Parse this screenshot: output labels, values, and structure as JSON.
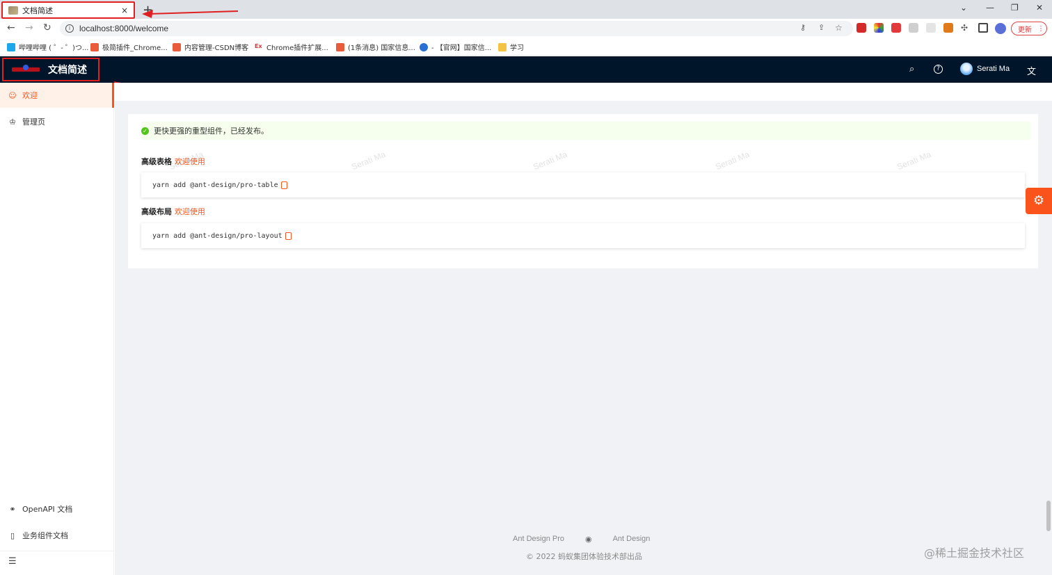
{
  "browser": {
    "tab_title": "文档简述",
    "tab_close": "×",
    "new_tab": "+",
    "url": "localhost:8000/welcome",
    "update_label": "更新",
    "bookmarks": [
      {
        "label": "哔哩哔哩 ( ゜- ゜)つ...",
        "color": "#1aa7ec"
      },
      {
        "label": "极简插件_Chrome...",
        "color": "#e85c3b"
      },
      {
        "label": "内容管理-CSDN博客",
        "color": "#e85c3b"
      },
      {
        "label": "Chrome插件扩展...",
        "color": "#d33"
      },
      {
        "label": "(1条消息) 国家信息...",
        "color": "#e85c3b"
      },
      {
        "label": "- 【官网】国家信...",
        "color": "#2a6fd6"
      },
      {
        "label": "学习",
        "color": "#f3c343"
      }
    ]
  },
  "header": {
    "title": "文档简述",
    "user_name": "Serati Ma"
  },
  "sidebar": {
    "items": [
      {
        "label": "欢迎",
        "icon": "smile-icon",
        "active": true
      },
      {
        "label": "管理页",
        "icon": "crown-icon",
        "active": false
      }
    ],
    "bottom_items": [
      {
        "label": "OpenAPI 文档",
        "icon": "link-icon"
      },
      {
        "label": "业务组件文档",
        "icon": "book-icon"
      }
    ]
  },
  "main": {
    "alert": "更快更强的重型组件，已经发布。",
    "sections": [
      {
        "title": "高级表格",
        "link": "欢迎使用",
        "code": "yarn add @ant-design/pro-table"
      },
      {
        "title": "高级布局",
        "link": "欢迎使用",
        "code": "yarn add @ant-design/pro-layout"
      }
    ],
    "watermark": "Serati Ma"
  },
  "footer": {
    "links": [
      "Ant Design Pro",
      "Ant Design"
    ],
    "copyright": "© 2022 蚂蚁集团体验技术部出品"
  },
  "overlay": {
    "juejin": "@稀土掘金技术社区"
  },
  "colors": {
    "primary": "#fa541c",
    "header_bg": "#001529",
    "annotation": "#e02020"
  }
}
